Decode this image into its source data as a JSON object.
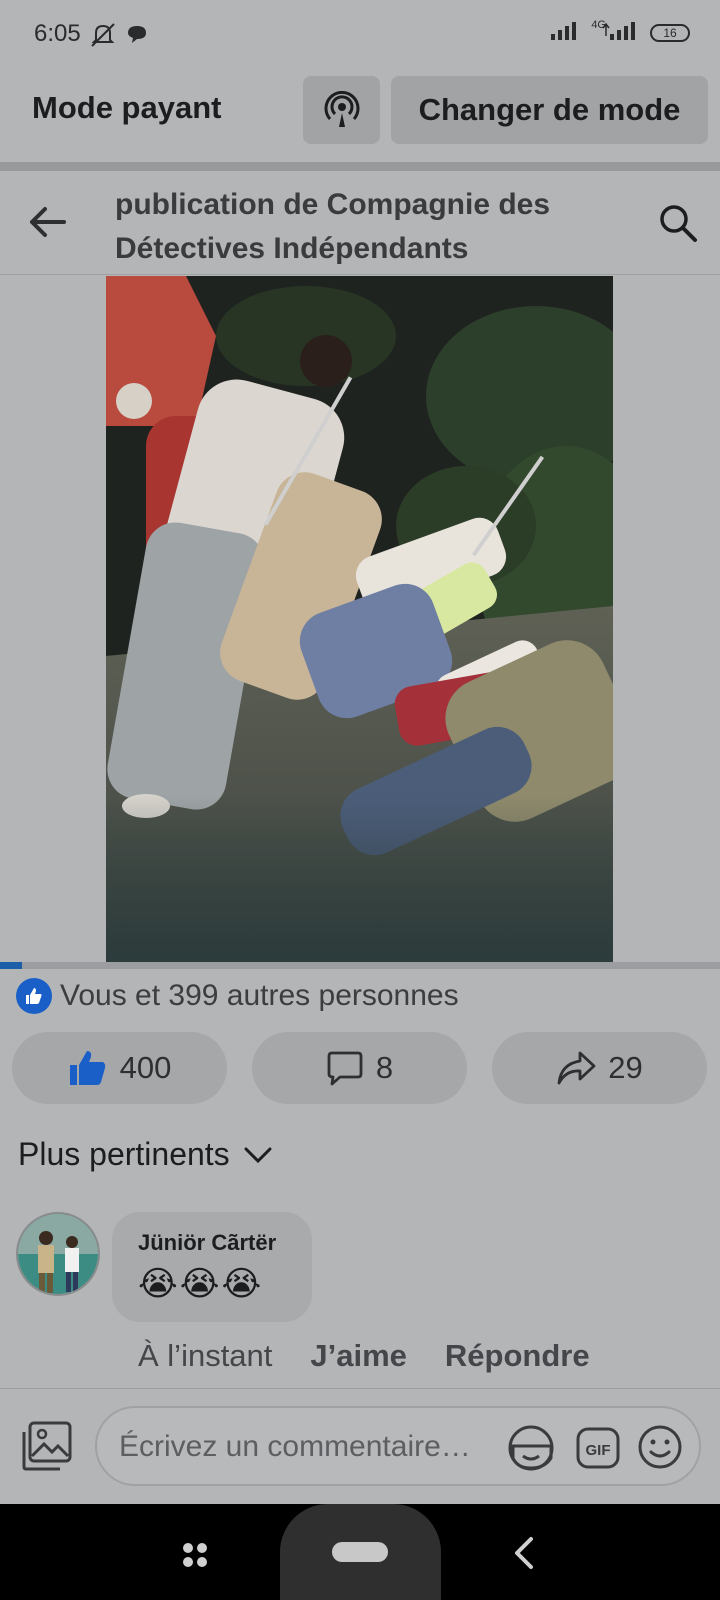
{
  "status_bar": {
    "time": "6:05",
    "network": "4G",
    "battery": "16"
  },
  "mode_bar": {
    "title": "Mode payant",
    "change_mode_label": "Changer de mode"
  },
  "post_header": {
    "title": "publication de Compagnie des Détectives Indépendants"
  },
  "video": {
    "progress_fraction": 0.03
  },
  "reactions": {
    "summary": "Vous et 399 autres personnes",
    "like_count": "400",
    "comment_count": "8",
    "share_count": "29"
  },
  "sort": {
    "label": "Plus pertinents"
  },
  "comment": {
    "author": "Jüniör Cãrtër",
    "text": "😭😭😭",
    "time": "À l’instant",
    "like_label": "J’aime",
    "reply_label": "Répondre"
  },
  "composer": {
    "placeholder": "Écrivez un commentaire…"
  },
  "colors": {
    "background": "#b4b5b7",
    "accent_blue": "#1a5fc7",
    "button_gray": "#a6a7a9"
  }
}
